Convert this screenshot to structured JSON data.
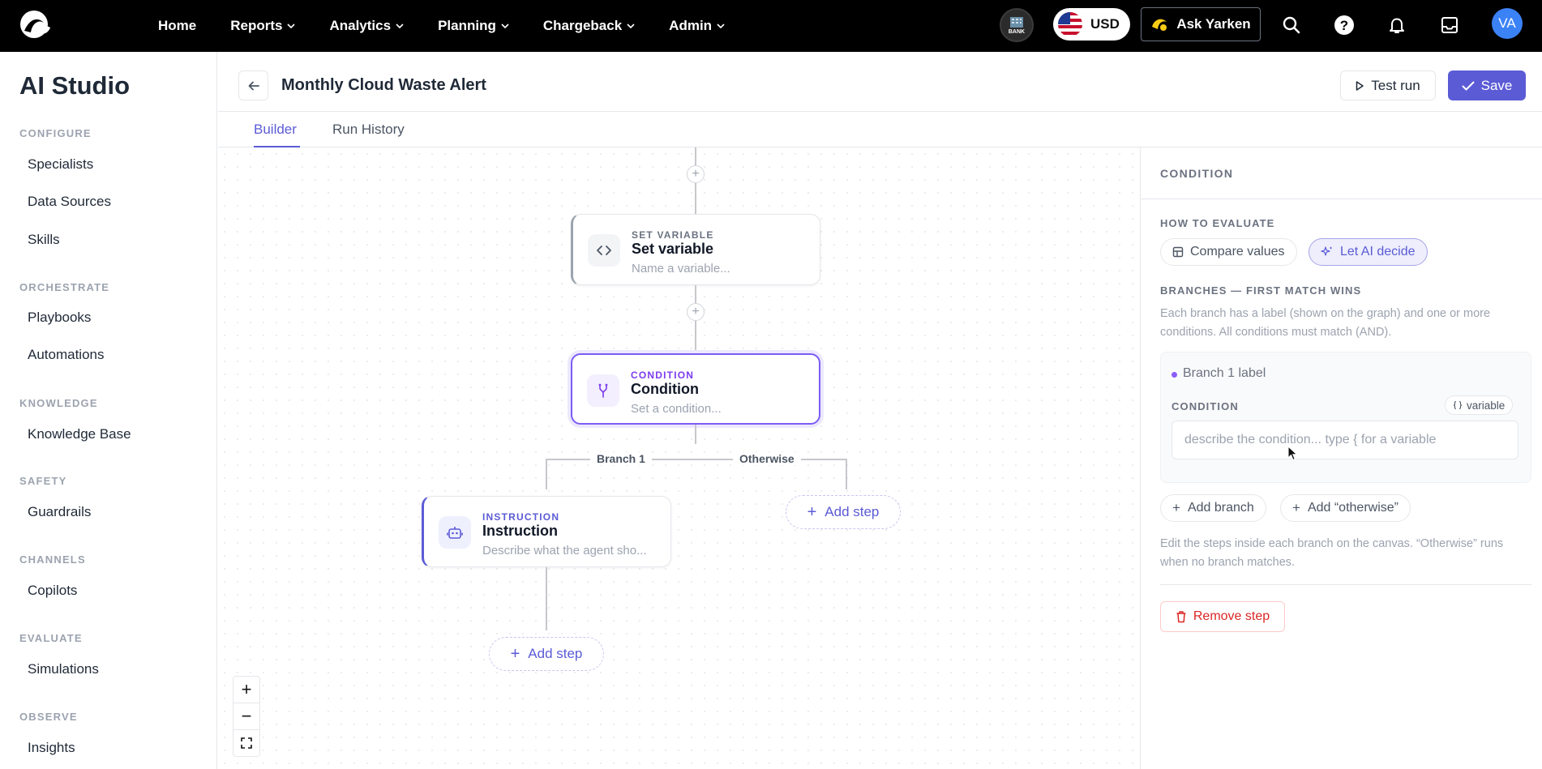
{
  "topbar": {
    "nav": [
      {
        "label": "Home",
        "dropdown": false
      },
      {
        "label": "Reports",
        "dropdown": true
      },
      {
        "label": "Analytics",
        "dropdown": true
      },
      {
        "label": "Planning",
        "dropdown": true
      },
      {
        "label": "Chargeback",
        "dropdown": true
      },
      {
        "label": "Admin",
        "dropdown": true
      }
    ],
    "bank_label": "BANK",
    "currency": "USD",
    "ask_label": "Ask Yarken",
    "avatar_initials": "VA",
    "icons": [
      "search-icon",
      "help-icon",
      "bell-icon",
      "inbox-icon"
    ]
  },
  "sidebar": {
    "title": "AI Studio",
    "sections": [
      {
        "label": "CONFIGURE",
        "items": [
          "Specialists",
          "Data Sources",
          "Skills"
        ]
      },
      {
        "label": "ORCHESTRATE",
        "items": [
          "Playbooks",
          "Automations"
        ]
      },
      {
        "label": "KNOWLEDGE",
        "items": [
          "Knowledge Base"
        ]
      },
      {
        "label": "SAFETY",
        "items": [
          "Guardrails"
        ]
      },
      {
        "label": "CHANNELS",
        "items": [
          "Copilots"
        ]
      },
      {
        "label": "EVALUATE",
        "items": [
          "Simulations"
        ]
      },
      {
        "label": "OBSERVE",
        "items": [
          "Insights"
        ]
      }
    ]
  },
  "header": {
    "title": "Monthly Cloud Waste Alert",
    "test_run_label": "Test run",
    "save_label": "Save"
  },
  "tabs": [
    {
      "label": "Builder",
      "active": true
    },
    {
      "label": "Run History",
      "active": false
    }
  ],
  "canvas": {
    "set_variable_node": {
      "kind": "SET VARIABLE",
      "title": "Set variable",
      "subtitle": "Name a variable..."
    },
    "condition_node": {
      "kind": "CONDITION",
      "title": "Condition",
      "subtitle": "Set a condition..."
    },
    "instruction_node": {
      "kind": "INSTRUCTION",
      "title": "Instruction",
      "subtitle": "Describe what the agent sho..."
    },
    "branch_1_label": "Branch 1",
    "otherwise_label": "Otherwise",
    "add_step_label": "Add step",
    "accent": "#5b5bd6"
  },
  "panel": {
    "title": "CONDITION",
    "how_to_evaluate_label": "HOW TO EVALUATE",
    "compare_values_label": "Compare values",
    "let_ai_decide_label": "Let AI decide",
    "branches_label": "BRANCHES — FIRST MATCH WINS",
    "branches_help": "Each branch has a label (shown on the graph) and one or more conditions. All conditions must match (AND).",
    "branch_card": {
      "label_placeholder": "Branch 1 label",
      "condition_label": "CONDITION",
      "variable_chip": "variable",
      "condition_placeholder": "describe the condition... type { for a variable"
    },
    "add_branch_label": "Add branch",
    "add_otherwise_label": "Add “otherwise”",
    "footer_help": "Edit the steps inside each branch on the canvas. “Otherwise” runs when no branch matches.",
    "remove_step_label": "Remove step"
  }
}
